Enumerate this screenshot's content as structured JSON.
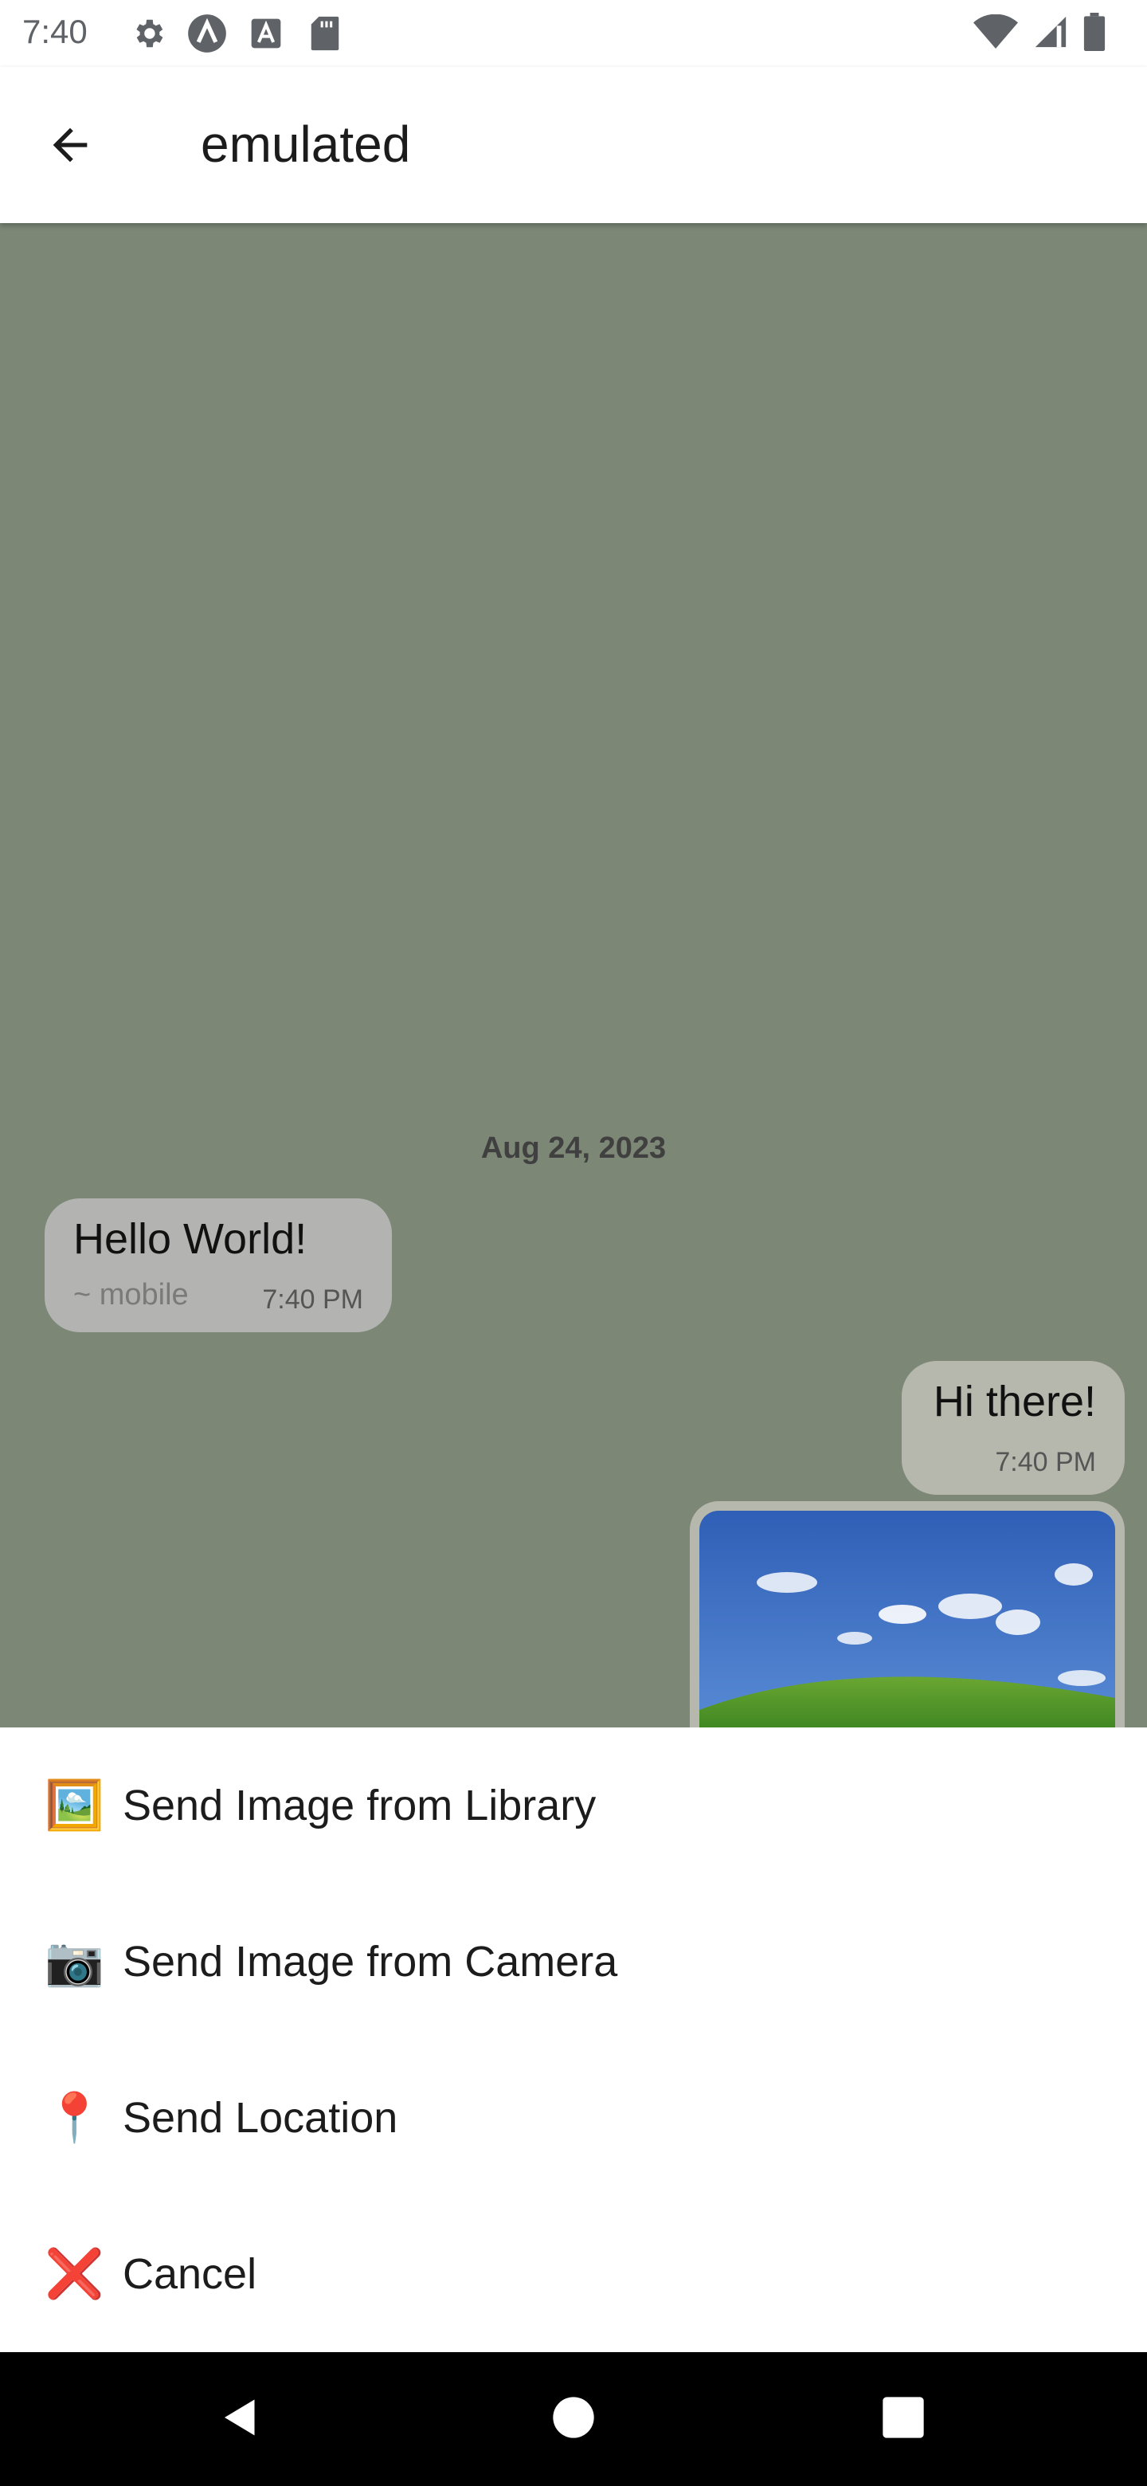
{
  "status_bar": {
    "time": "7:40",
    "left_icons": [
      "settings-icon",
      "app-icon",
      "font-icon",
      "sd-card-icon"
    ],
    "right_icons": [
      "wifi-icon",
      "signal-icon",
      "battery-icon"
    ]
  },
  "app_bar": {
    "back_icon": "arrow-back-icon",
    "title": "emulated"
  },
  "chat": {
    "background_color": "#7c8776",
    "date_separator": "Aug 24, 2023",
    "messages": [
      {
        "direction": "incoming",
        "text": "Hello World!",
        "sender": "~ mobile",
        "time": "7:40 PM"
      },
      {
        "direction": "outgoing",
        "text": "Hi there!",
        "time": "7:40 PM"
      },
      {
        "direction": "outgoing",
        "type": "image",
        "image": "landscape-photo"
      }
    ]
  },
  "action_sheet": {
    "items": [
      {
        "emoji": "🖼️",
        "label": "Send Image from Library"
      },
      {
        "emoji": "📷",
        "label": "Send Image from Camera"
      },
      {
        "emoji": "📍",
        "label": "Send Location"
      },
      {
        "emoji": "❌",
        "label": "Cancel"
      }
    ]
  },
  "nav_bar": {
    "buttons": [
      "back-triangle-icon",
      "home-circle-icon",
      "recents-square-icon"
    ]
  }
}
